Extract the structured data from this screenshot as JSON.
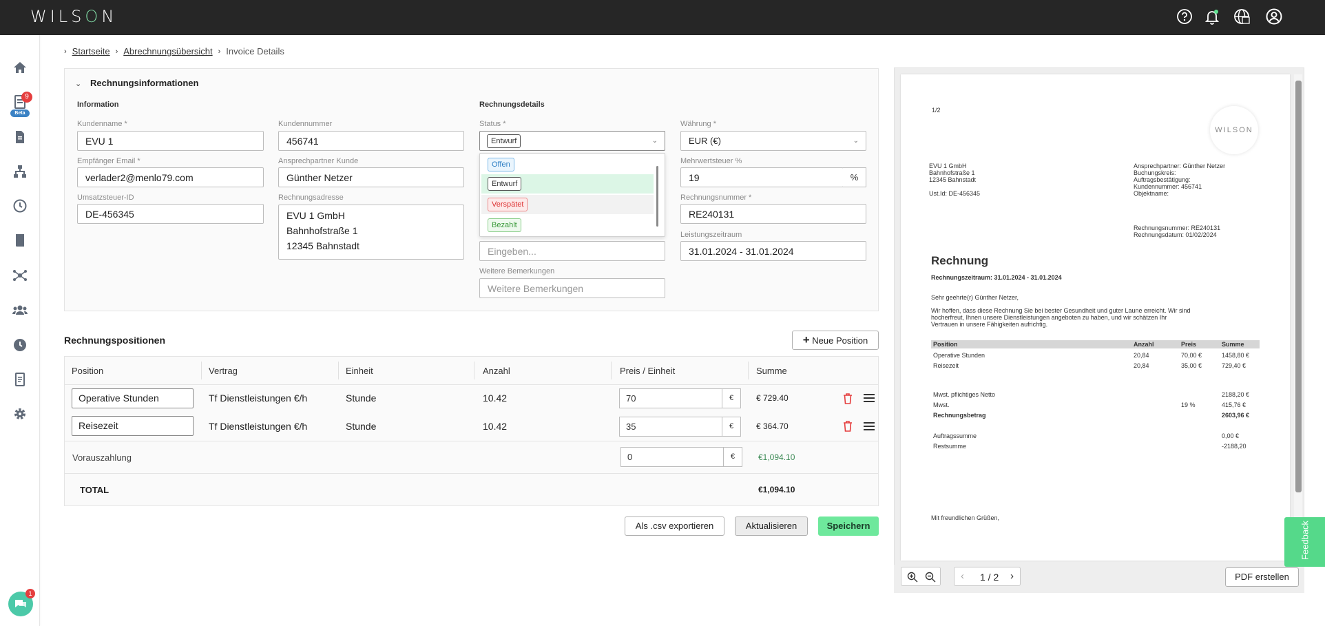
{
  "app": {
    "logo_left": "WILS",
    "logo_o": "O",
    "logo_right": "N"
  },
  "sidebar": {
    "notification_count": "9",
    "beta_label": "Beta"
  },
  "breadcrumb": {
    "home": "Startseite",
    "overview": "Abrechnungsübersicht",
    "current": "Invoice Details"
  },
  "invoice_info": {
    "section_title": "Rechnungsinformationen",
    "info_title": "Information",
    "details_title": "Rechnungsdetails",
    "customer_name_label": "Kundenname *",
    "customer_name": "EVU 1",
    "customer_number_label": "Kundennummer",
    "customer_number": "456741",
    "email_label": "Empfänger Email *",
    "email": "verlader2@menlo79.com",
    "contact_label": "Ansprechpartner Kunde",
    "contact": "Günther Netzer",
    "vat_id_label": "Umsatzsteuer-ID",
    "vat_id": "DE-456345",
    "address_label": "Rechnungsadresse",
    "address": "EVU 1 GmbH\nBahnhofstraße 1\n12345 Bahnstadt",
    "status_label": "Status *",
    "status_value": "Entwurf",
    "currency_label": "Währung *",
    "currency": "EUR (€)",
    "vat_label": "Mehrwertsteuer %",
    "vat": "19",
    "vat_unit": "%",
    "invoice_number_label": "Rechnungsnummer *",
    "invoice_number": "RE240131",
    "period_label": "Leistungszeitraum",
    "period": "31.01.2024 - 31.01.2024",
    "hidden_input_placeholder": "Eingeben...",
    "remarks_label": "Weitere Bemerkungen",
    "remarks_placeholder": "Weitere Bemerkungen",
    "status_options": [
      "Offen",
      "Entwurf",
      "Verspätet",
      "Bezahlt"
    ]
  },
  "positions": {
    "title": "Rechnungspositionen",
    "new_button": "Neue Position",
    "headers": [
      "Position",
      "Vertrag",
      "Einheit",
      "Anzahl",
      "Preis / Einheit",
      "Summe"
    ],
    "rows": [
      {
        "position": "Operative Stunden",
        "contract": "Tf Dienstleistungen €/h",
        "unit": "Stunde",
        "qty": "10.42",
        "price": "70",
        "currency": "€",
        "sum": "€ 729.40"
      },
      {
        "position": "Reisezeit",
        "contract": "Tf Dienstleistungen €/h",
        "unit": "Stunde",
        "qty": "10.42",
        "price": "35",
        "currency": "€",
        "sum": "€ 364.70"
      }
    ],
    "prepayment_label": "Vorauszahlung",
    "prepayment": "0",
    "prepayment_currency": "€",
    "prepayment_sum": "€1,094.10",
    "total_label": "TOTAL",
    "total": "€1,094.10"
  },
  "actions": {
    "export": "Als .csv exportieren",
    "update": "Aktualisieren",
    "save": "Speichern"
  },
  "preview": {
    "page_marker": "1/2",
    "logo": "WILSON",
    "sender": [
      "EVU 1 GmbH",
      "Bahnhofstraße 1",
      "12345 Bahnstadt"
    ],
    "ust": "Ust.Id: DE-456345",
    "meta": [
      "Ansprechpartner: Günther Netzer",
      "Buchungskreis:",
      "Auftragsbestätigung:",
      "Kundennummer: 456741",
      "Objektname:"
    ],
    "numbers": [
      "Rechnungsnummer: RE240131",
      "Rechnungsdatum: 01/02/2024"
    ],
    "heading": "Rechnung",
    "period": "Rechnungszeitraum: 31.01.2024 - 31.01.2024",
    "greeting": "Sehr geehrte(r) Günther Netzer,",
    "intro": [
      "Wir hoffen, dass diese Rechnung Sie bei bester Gesundheit und guter Laune erreicht. Wir sind",
      "hocherfreut, Ihnen unsere Dienstleistungen angeboten zu haben, und wir schätzen Ihr",
      "Vertrauen in unsere Fähigkeiten aufrichtig."
    ],
    "table_headers": [
      "Position",
      "Anzahl",
      "Preis",
      "Summe"
    ],
    "table_rows": [
      [
        "Operative Stunden",
        "20,84",
        "70,00 €",
        "1458,80 €"
      ],
      [
        "Reisezeit",
        "20,84",
        "35,00 €",
        "729,40 €"
      ]
    ],
    "net_label": "Mwst. pflichtiges Netto",
    "net": "2188,20 €",
    "tax_label": "Mwst.",
    "tax_rate": "19 %",
    "tax": "415,76 €",
    "gross_label": "Rechnungsbetrag",
    "gross": "2603,96 €",
    "order_sum_label": "Auftragssumme",
    "order_sum": "0,00 €",
    "rest_label": "Restsumme",
    "rest": "-2188,20",
    "closing": "Mit freundlichen Grüßen,",
    "pager": "1 / 2",
    "create_pdf": "PDF erstellen"
  },
  "feedback": "Feedback",
  "chat_badge": "1",
  "colors": {
    "accent": "#6ee89c",
    "topbar": "#262626",
    "badge": "#e53e3e"
  }
}
